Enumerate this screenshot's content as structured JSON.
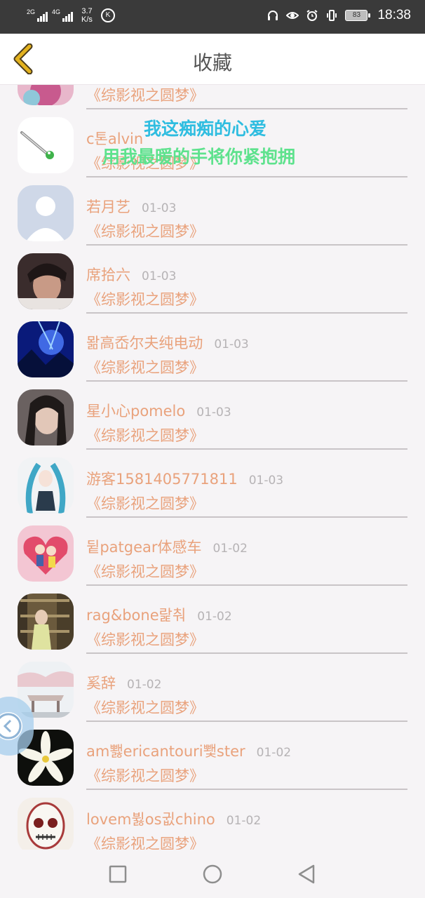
{
  "status_bar": {
    "net1": "2G",
    "net2": "4G",
    "speed_value": "3.7",
    "speed_unit": "K/s",
    "k_badge": "K",
    "battery": "83",
    "time": "18:38"
  },
  "header": {
    "title": "收藏"
  },
  "lyrics": {
    "line1": "我这痴痴的心爱",
    "line2": "用我最暖的手将你紧抱拥"
  },
  "favorites": [
    {
      "name": "",
      "date": "",
      "work": "《综影视之圆梦》"
    },
    {
      "name": "c톤alvin",
      "date": "",
      "work": "《综影视之圆梦》"
    },
    {
      "name": "若月艺",
      "date": "01-03",
      "work": "《综影视之圆梦》"
    },
    {
      "name": "席拾六",
      "date": "01-03",
      "work": "《综影视之圆梦》"
    },
    {
      "name": "뫎高岙尔夫纯电动",
      "date": "01-03",
      "work": "《综影视之圆梦》"
    },
    {
      "name": "星小心pomelo",
      "date": "01-03",
      "work": "《综影视之圆梦》"
    },
    {
      "name": "游客1581405771811",
      "date": "01-03",
      "work": "《综影视之圆梦》"
    },
    {
      "name": "뒽patgear体感车",
      "date": "01-02",
      "work": "《综影视之圆梦》"
    },
    {
      "name": "rag&bone랉춰",
      "date": "01-02",
      "work": "《综影视之圆梦》"
    },
    {
      "name": "奚辞",
      "date": "01-02",
      "work": "《综影视之圆梦》"
    },
    {
      "name": "am뾇ericantouri뾏ster",
      "date": "01-02",
      "work": "《综影视之圆梦》"
    },
    {
      "name": "lovem뷣os귒chino",
      "date": "01-02",
      "work": "《综影视之圆梦》"
    }
  ],
  "colors": {
    "accent": "#e9a27c",
    "date": "#b6b3b5",
    "lyric1": "#2fbde0",
    "lyric2": "#5ee28d",
    "back_arrow": "#e3b21f"
  }
}
